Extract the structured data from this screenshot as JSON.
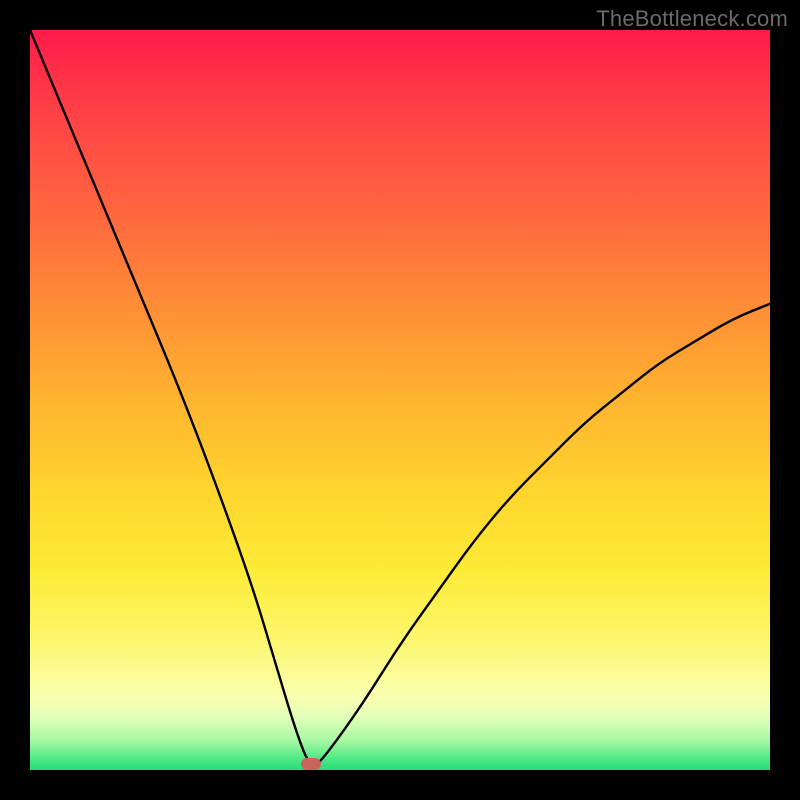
{
  "watermark": "TheBottleneck.com",
  "chart_data": {
    "type": "line",
    "title": "",
    "xlabel": "",
    "ylabel": "",
    "xlim": [
      0,
      100
    ],
    "ylim": [
      0,
      100
    ],
    "optimum_x": 38,
    "series": [
      {
        "name": "bottleneck-curve",
        "x": [
          0,
          5,
          10,
          15,
          20,
          25,
          30,
          33,
          36,
          38,
          40,
          45,
          50,
          55,
          60,
          65,
          70,
          75,
          80,
          85,
          90,
          95,
          100
        ],
        "values": [
          100,
          88,
          76,
          64,
          52,
          39,
          25,
          15,
          5,
          0,
          2,
          9,
          17,
          24,
          31,
          37,
          42,
          47,
          51,
          55,
          58,
          61,
          63
        ]
      }
    ],
    "marker": {
      "x": 38,
      "y": 0,
      "color": "#c9645c"
    }
  },
  "colors": {
    "frame": "#000000",
    "watermark": "#6b6b6b",
    "curve": "#000000",
    "marker": "#c9645c"
  }
}
